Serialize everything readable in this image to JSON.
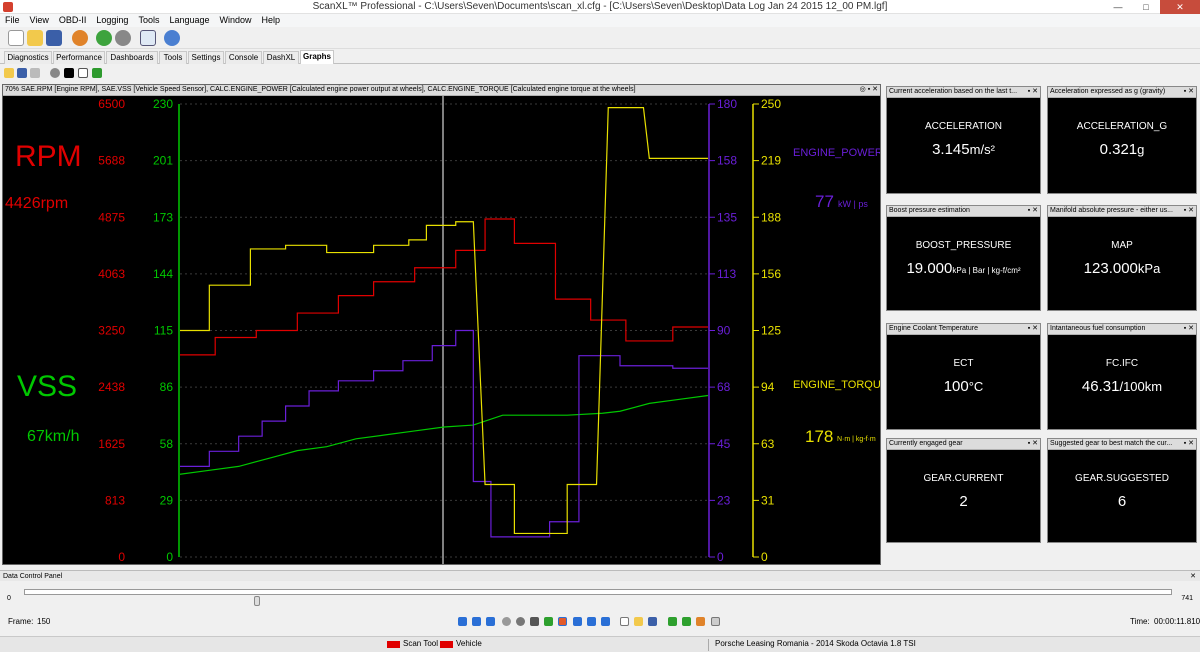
{
  "window": {
    "title": "ScanXL™ Professional - C:\\Users\\Seven\\Documents\\scan_xl.cfg - [C:\\Users\\Seven\\Desktop\\Data Log Jan 24 2015 12_00 PM.lgf]",
    "minimize": "—",
    "maximize": "□",
    "close": "✕"
  },
  "menu": [
    "File",
    "View",
    "OBD-II",
    "Logging",
    "Tools",
    "Language",
    "Window",
    "Help"
  ],
  "tabs": [
    "Diagnostics",
    "Performance",
    "Dashboards",
    "Tools",
    "Settings",
    "Console",
    "DashXL",
    "Graphs"
  ],
  "active_tab": "Graphs",
  "graph": {
    "header": "70% SAE.RPM [Engine RPM], SAE.VSS [Vehicle Speed Sensor], CALC.ENGINE_POWER [Calculated engine power output at wheels], CALC.ENGINE_TORQUE [Calculated engine torque at the wheels]",
    "controls": "◎ ▪ ✕",
    "rpm_label": "RPM",
    "rpm_value": "4426rpm",
    "vss_label": "VSS",
    "vss_value": "67km/h",
    "power_label": "ENGINE_POWER",
    "power_value": "77",
    "power_unit": "kW | ps",
    "torque_label": "ENGINE_TORQUE",
    "torque_value": "178",
    "torque_unit": "N·m | kg-f·m",
    "colors": {
      "rpm": "#e00000",
      "vss": "#00c800",
      "power": "#6a1fd8",
      "torque": "#e8e000"
    }
  },
  "chart_data": {
    "type": "line",
    "axes": {
      "rpm": [
        "6500",
        "5688",
        "4875",
        "4063",
        "3250",
        "2438",
        "1625",
        "813",
        "0"
      ],
      "vss": [
        "230",
        "201",
        "173",
        "144",
        "115",
        "86",
        "58",
        "29",
        "0"
      ],
      "power": [
        "180",
        "158",
        "135",
        "113",
        "90",
        "68",
        "45",
        "23",
        "0"
      ],
      "torque": [
        "250",
        "219",
        "188",
        "156",
        "125",
        "94",
        "63",
        "31",
        "0"
      ]
    },
    "series": [
      {
        "name": "SAE.RPM",
        "axis": "rpm",
        "ymax": 6500,
        "points": [
          [
            0,
            2900
          ],
          [
            0.06,
            2900
          ],
          [
            0.06,
            3150
          ],
          [
            0.13,
            3150
          ],
          [
            0.13,
            3250
          ],
          [
            0.2,
            3250
          ],
          [
            0.2,
            3500
          ],
          [
            0.27,
            3500
          ],
          [
            0.27,
            3750
          ],
          [
            0.33,
            3750
          ],
          [
            0.33,
            3950
          ],
          [
            0.4,
            3950
          ],
          [
            0.4,
            4150
          ],
          [
            0.47,
            4150
          ],
          [
            0.47,
            4400
          ],
          [
            0.52,
            4400
          ],
          [
            0.52,
            4850
          ],
          [
            0.57,
            4850
          ],
          [
            0.57,
            4500
          ],
          [
            0.64,
            4500
          ],
          [
            0.64,
            3700
          ],
          [
            0.7,
            3700
          ],
          [
            0.7,
            3400
          ],
          [
            0.76,
            3400
          ],
          [
            0.76,
            3100
          ],
          [
            0.84,
            3100
          ],
          [
            0.84,
            3300
          ],
          [
            0.9,
            3300
          ]
        ]
      },
      {
        "name": "SAE.VSS",
        "axis": "vss",
        "ymax": 230,
        "points": [
          [
            0,
            42
          ],
          [
            0.05,
            44
          ],
          [
            0.1,
            46
          ],
          [
            0.15,
            50
          ],
          [
            0.2,
            54
          ],
          [
            0.25,
            56
          ],
          [
            0.3,
            60
          ],
          [
            0.35,
            62
          ],
          [
            0.4,
            64
          ],
          [
            0.45,
            66
          ],
          [
            0.5,
            67
          ],
          [
            0.55,
            72
          ],
          [
            0.6,
            72
          ],
          [
            0.66,
            72
          ],
          [
            0.72,
            73
          ],
          [
            0.75,
            74
          ],
          [
            0.8,
            78
          ],
          [
            0.85,
            80
          ],
          [
            0.9,
            82
          ]
        ]
      },
      {
        "name": "CALC.ENGINE_POWER",
        "axis": "power",
        "ymax": 180,
        "points": [
          [
            0,
            36
          ],
          [
            0.05,
            36
          ],
          [
            0.05,
            42
          ],
          [
            0.1,
            42
          ],
          [
            0.1,
            48
          ],
          [
            0.14,
            48
          ],
          [
            0.14,
            54
          ],
          [
            0.18,
            54
          ],
          [
            0.18,
            60
          ],
          [
            0.22,
            60
          ],
          [
            0.22,
            66
          ],
          [
            0.27,
            66
          ],
          [
            0.27,
            70
          ],
          [
            0.33,
            70
          ],
          [
            0.33,
            74
          ],
          [
            0.38,
            74
          ],
          [
            0.38,
            78
          ],
          [
            0.43,
            78
          ],
          [
            0.43,
            84
          ],
          [
            0.47,
            84
          ],
          [
            0.47,
            90
          ],
          [
            0.5,
            90
          ],
          [
            0.5,
            30
          ],
          [
            0.53,
            30
          ],
          [
            0.53,
            8
          ],
          [
            0.63,
            8
          ],
          [
            0.63,
            14
          ],
          [
            0.68,
            14
          ],
          [
            0.68,
            80
          ],
          [
            0.75,
            80
          ],
          [
            0.75,
            76
          ],
          [
            0.84,
            76
          ],
          [
            0.84,
            75
          ],
          [
            0.9,
            75
          ]
        ]
      },
      {
        "name": "CALC.ENGINE_TORQUE",
        "axis": "torque",
        "ymax": 250,
        "points": [
          [
            0,
            125
          ],
          [
            0.05,
            125
          ],
          [
            0.05,
            150
          ],
          [
            0.12,
            150
          ],
          [
            0.12,
            170
          ],
          [
            0.18,
            170
          ],
          [
            0.18,
            172
          ],
          [
            0.25,
            172
          ],
          [
            0.25,
            168
          ],
          [
            0.33,
            168
          ],
          [
            0.33,
            172
          ],
          [
            0.39,
            172
          ],
          [
            0.39,
            175
          ],
          [
            0.42,
            175
          ],
          [
            0.42,
            183
          ],
          [
            0.47,
            183
          ],
          [
            0.47,
            185
          ],
          [
            0.5,
            185
          ],
          [
            0.52,
            40
          ],
          [
            0.57,
            40
          ],
          [
            0.57,
            13
          ],
          [
            0.66,
            13
          ],
          [
            0.66,
            40
          ],
          [
            0.71,
            40
          ],
          [
            0.73,
            248
          ],
          [
            0.79,
            248
          ],
          [
            0.8,
            220
          ],
          [
            0.9,
            220
          ]
        ]
      }
    ]
  },
  "gauges": [
    {
      "header": "Current acceleration based on the last t...",
      "name": "ACCELERATION",
      "value": "3.145",
      "unit": "m/s²"
    },
    {
      "header": "Acceleration expressed as g (gravity)",
      "name": "ACCELERATION_G",
      "value": "0.321",
      "unit": "g"
    },
    {
      "header": "Boost pressure estimation",
      "name": "BOOST_PRESSURE",
      "value": "19.000",
      "unit": "kPa | Bar | kg-f/cm²"
    },
    {
      "header": "Manifold absolute pressure - either us...",
      "name": "MAP",
      "value": "123.000",
      "unit": "kPa"
    },
    {
      "header": "Engine Coolant Temperature",
      "name": "ECT",
      "value": "100",
      "unit": "°C"
    },
    {
      "header": "Intantaneous fuel consumption",
      "name": "FC.IFC",
      "value": "46.31",
      "unit": "/100km"
    },
    {
      "header": "Currently engaged gear",
      "name": "GEAR.CURRENT",
      "value": "2",
      "unit": ""
    },
    {
      "header": "Suggested gear to best match the cur...",
      "name": "GEAR.SUGGESTED",
      "value": "6",
      "unit": ""
    }
  ],
  "gauge_controls": "▪ ✕",
  "data_control": {
    "title": "Data Control Panel",
    "close": "✕",
    "slider_min": "0",
    "slider_max": "741",
    "slider_pos": 0.2,
    "frame_label": "Frame:",
    "frame_value": "150",
    "time_label": "Time:",
    "time_value": "00:00:11.810"
  },
  "status": {
    "scan_tool": "Scan Tool",
    "vehicle": "Vehicle",
    "vehicle_info": "Porsche Leasing Romania - 2014 Skoda Octavia 1.8 TSI"
  }
}
